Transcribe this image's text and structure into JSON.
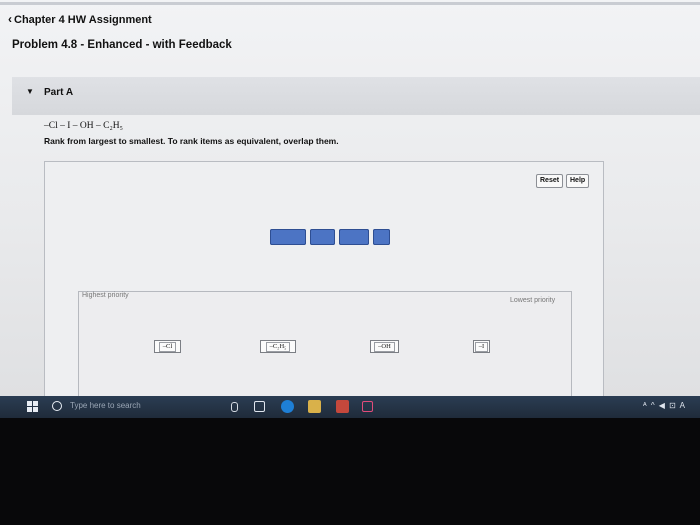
{
  "nav": {
    "chevron": "‹",
    "back_label": "Chapter 4 HW Assignment"
  },
  "problem": {
    "title": "Problem 4.8 - Enhanced - with Feedback"
  },
  "part": {
    "caret": "▼",
    "label": "Part A"
  },
  "question": {
    "formula": "–Cl – I – OH – C₂H₅",
    "instructions": "Rank from largest to smallest. To rank items as equivalent, overlap them."
  },
  "buttons": {
    "reset": "Reset",
    "help": "Help"
  },
  "tile_color": "#4c74c4",
  "ranking": {
    "highest_label": "Highest priority",
    "lowest_label": "Lowest priority",
    "items": [
      "–Cl",
      "–C₂H₅",
      "–OH",
      "–I"
    ]
  },
  "taskbar": {
    "start_icon": "windows-logo-icon",
    "search_icon": "cortana-circle-icon",
    "search_placeholder": "Type here to search",
    "tray_text": "ᴬ ^ ◀ ⊡ A",
    "accent": "#1f2b3a"
  }
}
